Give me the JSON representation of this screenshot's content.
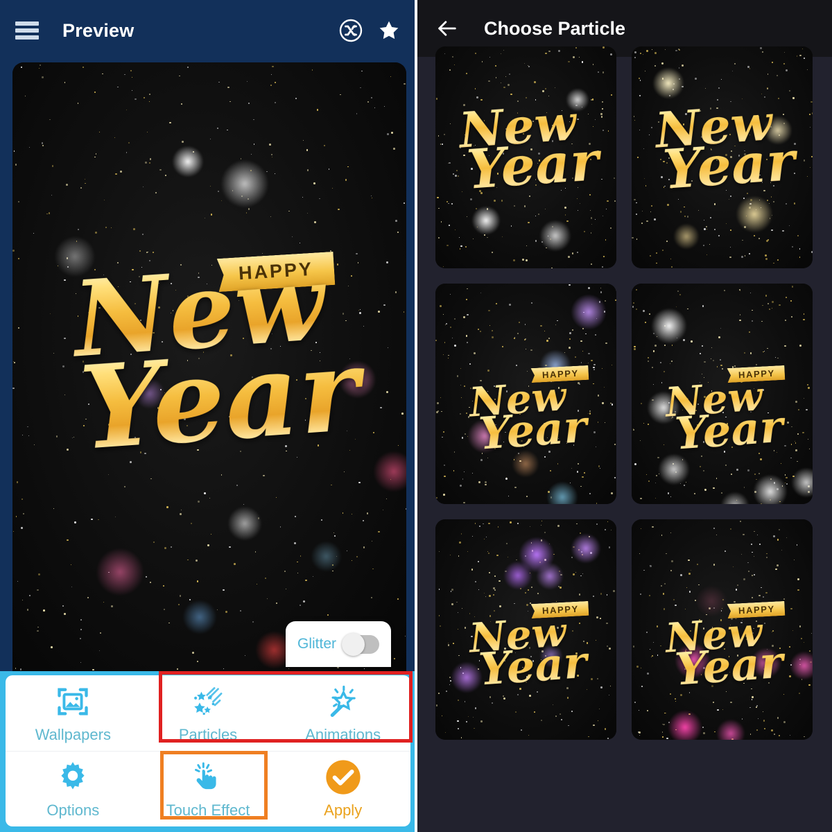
{
  "left_panel": {
    "header": {
      "title": "Preview",
      "menu_icon": "hamburger-menu-icon",
      "shuffle_icon": "shuffle-icon",
      "favorite_icon": "star-icon"
    },
    "preview": {
      "ribbon_text": "HAPPY",
      "line1": "New",
      "line2": "Year"
    },
    "glitter": {
      "label": "Glitter",
      "state": "off"
    },
    "toolbar": {
      "items": [
        {
          "label": "Wallpapers",
          "icon": "image-frame-icon",
          "accent": "#5fb8cf"
        },
        {
          "label": "Particles",
          "icon": "sparkle-stars-icon",
          "accent": "#5fb8cf"
        },
        {
          "label": "Animations",
          "icon": "magic-wand-icon",
          "accent": "#5fb8cf"
        },
        {
          "label": "Options",
          "icon": "gear-icon",
          "accent": "#5fb8cf"
        },
        {
          "label": "Touch Effect",
          "icon": "tap-hand-icon",
          "accent": "#5fb8cf"
        },
        {
          "label": "Apply",
          "icon": "check-circle-icon",
          "accent": "#eaa21e"
        }
      ]
    },
    "annotations": [
      {
        "name": "particles-animations-highlight",
        "color": "#e02121"
      },
      {
        "name": "touch-effect-highlight",
        "color": "#ef7f22"
      }
    ]
  },
  "right_panel": {
    "header": {
      "title": "Choose Particle",
      "back_icon": "back-arrow-icon"
    },
    "tiles": [
      {
        "ribbon": "",
        "line1": "New",
        "line2": "Year",
        "particle": "white-sparkle-stars"
      },
      {
        "ribbon": "",
        "line1": "New",
        "line2": "Year",
        "particle": "warm-gold-starburst"
      },
      {
        "ribbon": "HAPPY",
        "line1": "New",
        "line2": "Year",
        "particle": "rainbow-bokeh"
      },
      {
        "ribbon": "HAPPY",
        "line1": "New",
        "line2": "Year",
        "particle": "white-glow-orbs"
      },
      {
        "ribbon": "HAPPY",
        "line1": "New",
        "line2": "Year",
        "particle": "purple-stars"
      },
      {
        "ribbon": "HAPPY",
        "line1": "New",
        "line2": "Year",
        "particle": "pink-magenta-glow"
      }
    ]
  },
  "colors": {
    "left_header_bg": "#12305a",
    "right_header_bg": "#151519",
    "right_panel_bg": "#22222e",
    "accent_cyan": "#3ab9e8",
    "label_cyan": "#5fb8cf",
    "apply_orange": "#eaa21e",
    "annotation_red": "#e02121",
    "annotation_orange": "#ef7f22"
  }
}
